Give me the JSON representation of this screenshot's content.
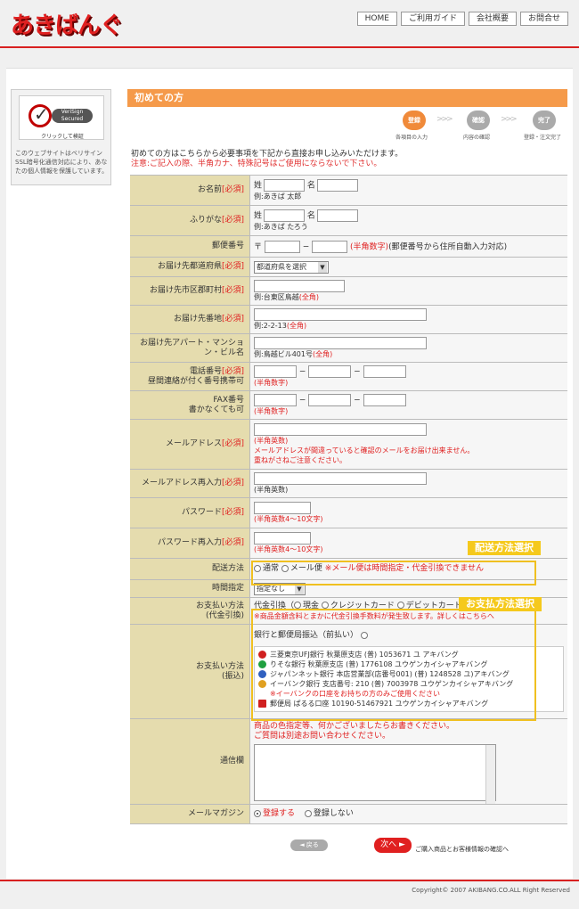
{
  "header": {
    "logo": "あきばんぐ",
    "nav": [
      "HOME",
      "ご利用ガイド",
      "会社概要",
      "お問合せ"
    ]
  },
  "sidebar": {
    "badge_label": "VeriSign Secured",
    "badge_caption": "クリックして検証",
    "note": "このウェブサイトはベリサインSSL暗号化通信対応により、あなたの個人情報を保護しています。"
  },
  "page": {
    "title": "初めての方",
    "steps": [
      {
        "label": "登録",
        "caption": "各項目の入力",
        "color": "#f08a3a"
      },
      {
        "label": "確認",
        "caption": "内容の確認",
        "color": "#aaaaaa"
      },
      {
        "label": "完了",
        "caption": "登録・注文完了",
        "color": "#aaaaaa"
      }
    ],
    "intro": "初めての方はこちらから必要事項を下記から直接お申し込みいただけます。",
    "warning": "注意:ご記入の際、半角カナ、特殊記号はご使用にならないで下さい。"
  },
  "form": {
    "required": "[必須]",
    "name": {
      "label": "お名前",
      "sei": "姓",
      "mei": "名",
      "example": "例:あきば 太郎"
    },
    "kana": {
      "label": "ふりがな",
      "sei": "姓",
      "mei": "名",
      "example": "例:あきば たろう"
    },
    "zip": {
      "label": "郵便番号",
      "mark": "〒",
      "note": "(半角数字)",
      "note2": "(郵便番号から住所自動入力対応)"
    },
    "pref": {
      "label": "お届け先都道府県",
      "value": "都道府県を選択"
    },
    "city": {
      "label": "お届け先市区郡町村",
      "example": "例:台東区鳥越",
      "note": "(全角)"
    },
    "street": {
      "label": "お届け先番地",
      "example": "例:2-2-13",
      "note": "(全角)"
    },
    "building": {
      "label": "お届け先アパート・マンション・ビル名",
      "example": "例:鳥越ビル401号",
      "note": "(全角)"
    },
    "tel": {
      "label": "電話番号",
      "sub": "昼間連絡が付く番号携帯可",
      "note": "(半角数字)"
    },
    "fax": {
      "label": "FAX番号",
      "sub": "書かなくても可",
      "note": "(半角数字)"
    },
    "email": {
      "label": "メールアドレス",
      "note": "(半角英数)",
      "warn1": "メールアドレスが間違っていると確認のメールをお届け出来ません。",
      "warn2": "重ねがさねご注意ください。"
    },
    "email2": {
      "label": "メールアドレス再入力",
      "note": "(半角英数)"
    },
    "password": {
      "label": "パスワード",
      "note": "(半角英数4〜10文字)"
    },
    "password2": {
      "label": "パスワード再入力",
      "note": "(半角英数4〜10文字)"
    },
    "delivery": {
      "label": "配送方法",
      "opt1": "通常",
      "opt2": "メール便",
      "warn": "※メール便は時間指定・代金引換できません"
    },
    "time": {
      "label": "時間指定",
      "value": "指定なし"
    },
    "payment": {
      "label": "お支払い方法",
      "sub": "(代金引換)",
      "prefix": "代金引換（",
      "opt1": "現金",
      "opt2": "クレジットカード",
      "opt3": "デビットカード）",
      "warn": "※商品金額含料とまかに代金引換手数料が発生致します。詳しくはこちらへ"
    },
    "transfer": {
      "label": "お支払い方法",
      "sub": "(振込)",
      "head": "銀行と郵便局振込（前払い）",
      "banks": [
        {
          "text": "三菱東京UFJ銀行 秋葉原支店 (普) 1053671 ユ アキバング",
          "color": "#d02020"
        },
        {
          "text": "りそな銀行 秋葉原支店 (普) 1776108 ユウゲンカイシャアキバング",
          "color": "#20a040"
        },
        {
          "text": "ジャパンネット銀行 本店営業部(店番号001) (普) 1248528 ユ)アキバング",
          "color": "#3060c0"
        },
        {
          "text": "イーバンク銀行 支店番号: 210 (普) 7003978 ユウゲンカイシャアキバング",
          "color": "#e0a020"
        },
        {
          "text": "郵便局 ぱるる口座 10190-51467921 ユウゲンカイシャアキバング",
          "color": "#d02020"
        }
      ],
      "ebank_note": "※イーバンクの口座をお持ちの方のみご使用ください"
    },
    "message": {
      "label": "通信欄",
      "note1": "商品の色指定等、何かございましたらお書きください。",
      "note2": "ご質問は別途お問い合わせください。"
    },
    "magazine": {
      "label": "メールマガジン",
      "opt1": "登録する",
      "opt2": "登録しない"
    }
  },
  "callouts": {
    "delivery": "配送方法選択",
    "payment": "お支払方法選択"
  },
  "buttons": {
    "back": "◄ 戻る",
    "next": "次へ ►",
    "next_note": "ご購入商品とお客様情報の確認へ"
  },
  "footer": {
    "copyright": "Copyright© 2007 AKIBANG.CO.ALL Right Reserved"
  }
}
